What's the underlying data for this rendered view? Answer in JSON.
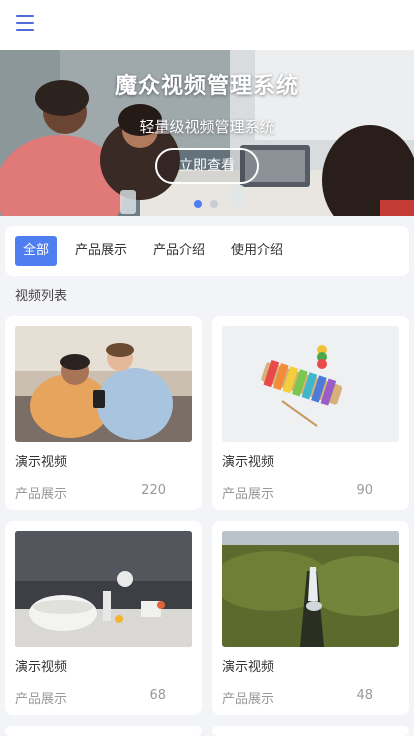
{
  "header": {
    "menu_icon": "hamburger-menu-icon"
  },
  "banner": {
    "title": "魔众视频管理系统",
    "subtitle": "轻量级视频管理系统",
    "button_label": "立即查看",
    "active_slide": 1,
    "slide_count": 2
  },
  "tabs": [
    {
      "label": "全部",
      "active": true
    },
    {
      "label": "产品展示",
      "active": false
    },
    {
      "label": "产品介绍",
      "active": false
    },
    {
      "label": "使用介绍",
      "active": false
    }
  ],
  "section_title": "视频列表",
  "videos": [
    {
      "title": "演示视频",
      "category": "产品展示",
      "count": "220"
    },
    {
      "title": "演示视频",
      "category": "产品展示",
      "count": "90"
    },
    {
      "title": "演示视频",
      "category": "产品展示",
      "count": "68"
    },
    {
      "title": "演示视频",
      "category": "产品展示",
      "count": "48"
    }
  ],
  "colors": {
    "accent": "#4f7ef0",
    "background": "#f3f4f7",
    "menu": "#4f6bd8"
  }
}
